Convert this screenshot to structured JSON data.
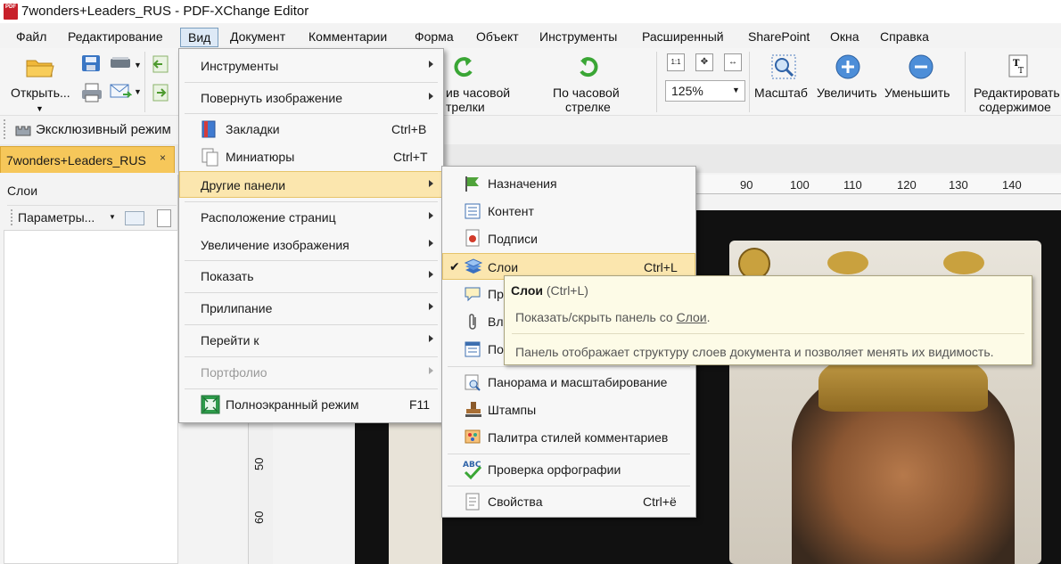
{
  "window": {
    "title": "7wonders+Leaders_RUS - PDF-XChange Editor"
  },
  "menubar": {
    "items": [
      "Файл",
      "Редактирование",
      "Вид",
      "Документ",
      "Комментарии",
      "Форма",
      "Объект",
      "Инструменты",
      "Расширенный",
      "SharePoint",
      "Окна",
      "Справка"
    ],
    "active": "Вид"
  },
  "toolbar": {
    "open_label": "Открыть...",
    "rotate_ccw_label_1": "ив часовой",
    "rotate_ccw_label_2": "трелки",
    "rotate_cw_label_1": "По часовой",
    "rotate_cw_label_2": "стрелке",
    "zoom_value": "125%",
    "zoom_tool_label": "Масштаб",
    "zoom_in_label": "Увеличить",
    "zoom_out_label": "Уменьшить",
    "edit_content_label_1": "Редактировать",
    "edit_content_label_2": "содержимое",
    "exclusive_mode_label": "Эксклюзивный режим"
  },
  "tab": {
    "label": "7wonders+Leaders_RUS",
    "close": "×"
  },
  "left_panel": {
    "header": "Слои",
    "options_label": "Параметры..."
  },
  "rulers": {
    "horizontal": [
      "90",
      "100",
      "110",
      "120",
      "130",
      "140"
    ],
    "vertical": [
      "50",
      "60"
    ]
  },
  "view_menu": {
    "items": [
      {
        "label": "Инструменты",
        "submenu": true
      },
      {
        "label": "Повернуть изображение",
        "submenu": true
      },
      {
        "label": "Закладки",
        "shortcut": "Ctrl+B"
      },
      {
        "label": "Миниатюры",
        "shortcut": "Ctrl+T"
      },
      {
        "label": "Другие панели",
        "submenu": true,
        "highlighted": true
      },
      {
        "label": "Расположение страниц",
        "submenu": true
      },
      {
        "label": "Увеличение изображения",
        "submenu": true
      },
      {
        "label": "Показать",
        "submenu": true
      },
      {
        "label": "Прилипание",
        "submenu": true
      },
      {
        "label": "Перейти к",
        "submenu": true
      },
      {
        "label": "Портфолио",
        "submenu": true,
        "disabled": true
      },
      {
        "label": "Полноэкранный режим",
        "shortcut": "F11"
      }
    ]
  },
  "panels_menu": {
    "items": [
      {
        "label": "Назначения"
      },
      {
        "label": "Контент"
      },
      {
        "label": "Подписи"
      },
      {
        "label": "Слои",
        "shortcut": "Ctrl+L",
        "checked": true,
        "highlighted": true
      },
      {
        "label": "Пр"
      },
      {
        "label": "Вл"
      },
      {
        "label": "По"
      },
      {
        "label": "Панорама и масштабирование"
      },
      {
        "label": "Штампы"
      },
      {
        "label": "Палитра стилей комментариев"
      },
      {
        "label": "Проверка орфографии"
      },
      {
        "label": "Свойства",
        "shortcut": "Ctrl+ё"
      }
    ]
  },
  "tooltip": {
    "title": "Слои",
    "shortcut": "(Ctrl+L)",
    "line1_prefix": "Показать/скрыть панель со ",
    "line1_link": "Слои",
    "line1_suffix": ".",
    "line2": "Панель отображает структуру слоев документа и позволяет менять их видимость."
  },
  "colors": {
    "menu_highlight": "#fbe6ae",
    "tab_active": "#f6c75a",
    "tooltip_bg": "#fdfbe7"
  }
}
